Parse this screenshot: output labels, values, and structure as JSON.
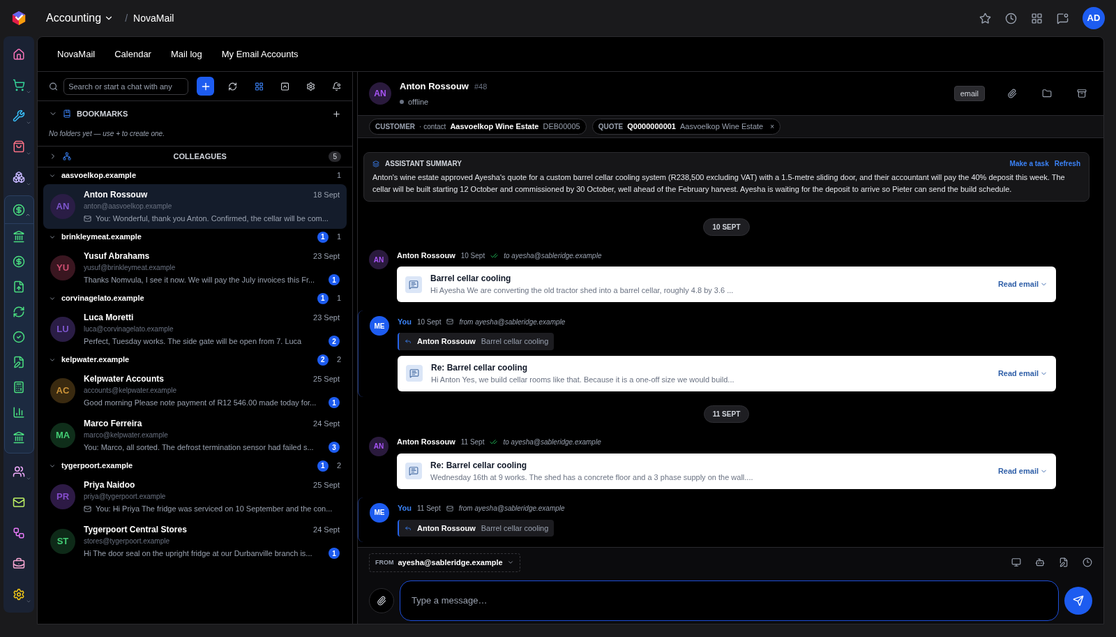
{
  "topbar": {
    "module": "Accounting",
    "separator": "/",
    "page": "NovaMail",
    "user_initials": "AD"
  },
  "tabs": [
    {
      "label": "NovaMail",
      "selected": false
    },
    {
      "label": "Calendar",
      "selected": false
    },
    {
      "label": "Mail log",
      "selected": false
    },
    {
      "label": "My Email Accounts",
      "selected": false
    }
  ],
  "chat_list": {
    "search": {
      "placeholder": "Search or start a chat with any"
    },
    "bookmarks": {
      "title": "BOOKMARKS",
      "expanded": true,
      "empty_text": "No folders yet — use + to create one."
    },
    "colleagues": {
      "title": "COLLEAGUES",
      "expanded": false,
      "count": "5"
    },
    "groups": [
      {
        "domain": "aasvoelkop.example",
        "count": "1",
        "contacts": [
          {
            "initials": "AN",
            "color": "#2a1d45",
            "name": "Anton Rossouw",
            "date": "18 Sept",
            "email": "anton@aasvoelkop.example",
            "preview": "You: Wonderful, thank you Anton. Confirmed, the cellar will be com...",
            "mail_icon": true,
            "selected": true
          }
        ]
      },
      {
        "domain": "brinkleymeat.example",
        "unread": "1",
        "count": "1",
        "contacts": [
          {
            "initials": "YU",
            "color": "#3a1620",
            "name": "Yusuf Abrahams",
            "date": "23 Sept",
            "email": "yusuf@brinkleymeat.example",
            "preview": "Thanks Nomvula, I see it now. We will pay the July invoices this Fr...",
            "mail_icon": false,
            "unread": "1",
            "selected": false
          }
        ]
      },
      {
        "domain": "corvinagelato.example",
        "unread": "1",
        "count": "1",
        "contacts": [
          {
            "initials": "LU",
            "color": "#2a1d45",
            "name": "Luca Moretti",
            "date": "23 Sept",
            "email": "luca@corvinagelato.example",
            "preview": "Perfect, Tuesday works. The side gate will be open from 7. Luca",
            "mail_icon": false,
            "unread": "2",
            "selected": false
          }
        ]
      },
      {
        "domain": "kelpwater.example",
        "unread": "2",
        "count": "2",
        "contacts": [
          {
            "initials": "AC",
            "color": "#3a2a10",
            "name": "Kelpwater Accounts",
            "date": "25 Sept",
            "email": "accounts@kelpwater.example",
            "preview": "Good morning Please note payment of R12 546.00 made today for...",
            "mail_icon": false,
            "unread": "1",
            "selected": false
          },
          {
            "initials": "MA",
            "color": "#0f2e1a",
            "name": "Marco Ferreira",
            "date": "24 Sept",
            "email": "marco@kelpwater.example",
            "preview": "You: Marco, all sorted. The defrost termination sensor had failed s...",
            "mail_icon": false,
            "unread": "3",
            "selected": false
          }
        ]
      },
      {
        "domain": "tygerpoort.example",
        "unread": "1",
        "count": "2",
        "contacts": [
          {
            "initials": "PR",
            "color": "#2d1a45",
            "name": "Priya Naidoo",
            "date": "25 Sept",
            "email": "priya@tygerpoort.example",
            "preview": "You: Hi Priya The fridge was serviced on 10 September and the con...",
            "mail_icon": true,
            "selected": false
          },
          {
            "initials": "ST",
            "color": "#0e2a18",
            "name": "Tygerpoort Central Stores",
            "date": "24 Sept",
            "email": "stores@tygerpoort.example",
            "preview": "Hi The door seal on the upright fridge at our Durbanville branch is...",
            "mail_icon": false,
            "unread": "1",
            "selected": false
          }
        ]
      }
    ]
  },
  "conversation": {
    "initials": "AN",
    "name": "Anton Rossouw",
    "number": "#48",
    "status": "offline",
    "online": false,
    "channel": "email",
    "customer_tag": {
      "label": "CUSTOMER",
      "role": "· contact",
      "name": "Aasvoelkop Wine Estate",
      "code": "DEB00005"
    },
    "quote_tag": {
      "label": "QUOTE",
      "number": "Q0000000001",
      "name": "Aasvoelkop Wine Estate",
      "close": "×"
    },
    "summary": {
      "title": "ASSISTANT SUMMARY",
      "actions": [
        "Make a task",
        "Refresh"
      ],
      "text": "Anton's wine estate approved Ayesha's quote for a custom barrel cellar cooling system (R238,500 excluding VAT) with a 1.5-metre sliding door, and their accountant will pay the 40% deposit this week. The cellar will be built starting 12 October and commissioned by 30 October, well ahead of the February harvest. Ayesha is waiting for the deposit to arrive so Pieter can send the build schedule."
    },
    "items": [
      {
        "kind": "date",
        "label": "10 SEPT"
      },
      {
        "kind": "incoming",
        "initials": "AN",
        "sender": "Anton Rossouw",
        "date": "10 Sept",
        "route": "to ayesha@sableridge.example",
        "email": {
          "subject": "Barrel cellar cooling",
          "preview": "Hi Ayesha We are converting the old tractor shed into a barrel cellar, roughly 4.8 by 3.6 ...",
          "action": "Read email"
        }
      },
      {
        "kind": "outgoing",
        "initials": "ME",
        "sender": "You",
        "date": "10 Sept",
        "route": "from ayesha@sableridge.example",
        "reply_to": {
          "name": "Anton Rossouw",
          "subject": "Barrel cellar cooling"
        },
        "email": {
          "subject": "Re: Barrel cellar cooling",
          "preview": "Hi Anton Yes, we build cellar rooms like that. Because it is a one-off size we would build...",
          "action": "Read email"
        }
      },
      {
        "kind": "date",
        "label": "11 SEPT"
      },
      {
        "kind": "incoming",
        "initials": "AN",
        "sender": "Anton Rossouw",
        "date": "11 Sept",
        "route": "to ayesha@sableridge.example",
        "email": {
          "subject": "Re: Barrel cellar cooling",
          "preview": "Wednesday 16th at 9 works. The shed has a concrete floor and a 3 phase supply on the wall....",
          "action": "Read email"
        }
      },
      {
        "kind": "outgoing",
        "initials": "ME",
        "sender": "You",
        "date": "11 Sept",
        "route": "from ayesha@sableridge.example",
        "reply_to": {
          "name": "Anton Rossouw",
          "subject": "Barrel cellar cooling"
        }
      }
    ],
    "composer": {
      "from_label": "FROM",
      "from": "ayesha@sableridge.example",
      "placeholder": "Type a message…"
    }
  }
}
